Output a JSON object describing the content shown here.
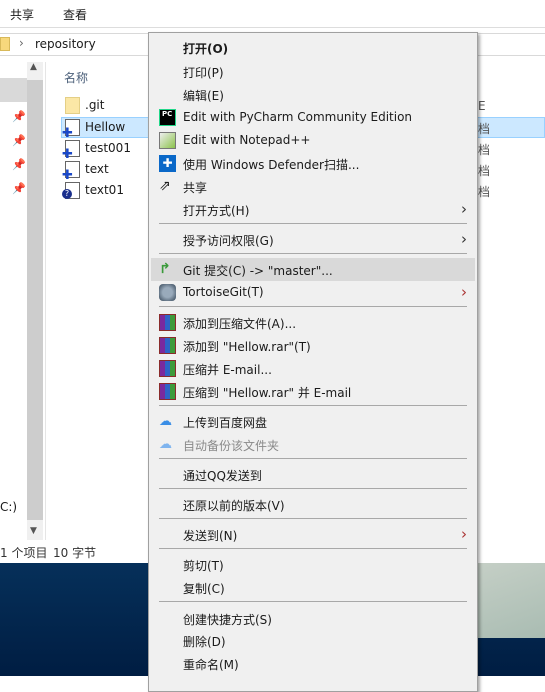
{
  "ribbon": {
    "tabs": [
      "共享",
      "查看"
    ]
  },
  "address": {
    "path": "repository"
  },
  "nav": {
    "drive_fragment": "C:)"
  },
  "list": {
    "column_name": "名称",
    "column_type_fragment": "E",
    "files": [
      {
        "name": ".git",
        "type": "folder",
        "type_text": ""
      },
      {
        "name": "Hellow",
        "type": "document",
        "type_text": "档",
        "selected": true
      },
      {
        "name": "test001",
        "type": "document",
        "type_text": "档"
      },
      {
        "name": "text",
        "type": "document",
        "type_text": "档"
      },
      {
        "name": "text01",
        "type": "unknown",
        "type_text": "档"
      }
    ]
  },
  "status": {
    "count": "1 个项目",
    "size": "10 字节"
  },
  "menu": {
    "items": [
      {
        "label": "打开(O)",
        "bold": true
      },
      {
        "label": "打印(P)"
      },
      {
        "label": "编辑(E)"
      },
      {
        "label": "Edit with PyCharm Community Edition",
        "icon": "pycharm-icon"
      },
      {
        "label": "Edit with Notepad++",
        "icon": "notepadpp-icon"
      },
      {
        "label": "使用 Windows Defender扫描...",
        "icon": "defender-shield-icon"
      },
      {
        "label": "共享",
        "icon": "share-icon"
      },
      {
        "label": "打开方式(H)",
        "submenu": true
      },
      {
        "label": "授予访问权限(G)",
        "submenu": true
      },
      {
        "label": "Git 提交(C) -> \"master\"...",
        "icon": "git-commit-icon",
        "highlighted": true
      },
      {
        "label": "TortoiseGit(T)",
        "icon": "tortoisegit-icon",
        "submenu": true
      },
      {
        "label": "添加到压缩文件(A)...",
        "icon": "winrar-icon"
      },
      {
        "label": "添加到 \"Hellow.rar\"(T)",
        "icon": "winrar-icon"
      },
      {
        "label": "压缩并 E-mail...",
        "icon": "winrar-icon"
      },
      {
        "label": "压缩到 \"Hellow.rar\" 并 E-mail",
        "icon": "winrar-icon"
      },
      {
        "label": "上传到百度网盘",
        "icon": "baidu-netdisk-icon"
      },
      {
        "label": "自动备份该文件夹",
        "icon": "baidu-netdisk-icon",
        "disabled": true
      },
      {
        "label": "通过QQ发送到"
      },
      {
        "label": "还原以前的版本(V)"
      },
      {
        "label": "发送到(N)",
        "submenu": true
      },
      {
        "label": "剪切(T)"
      },
      {
        "label": "复制(C)"
      },
      {
        "label": "创建快捷方式(S)"
      },
      {
        "label": "删除(D)"
      },
      {
        "label": "重命名(M)"
      }
    ]
  },
  "colors": {
    "selection": "#cce8ff",
    "highlight": "#d9d9d9",
    "menu_bg": "#f0f0f0"
  }
}
